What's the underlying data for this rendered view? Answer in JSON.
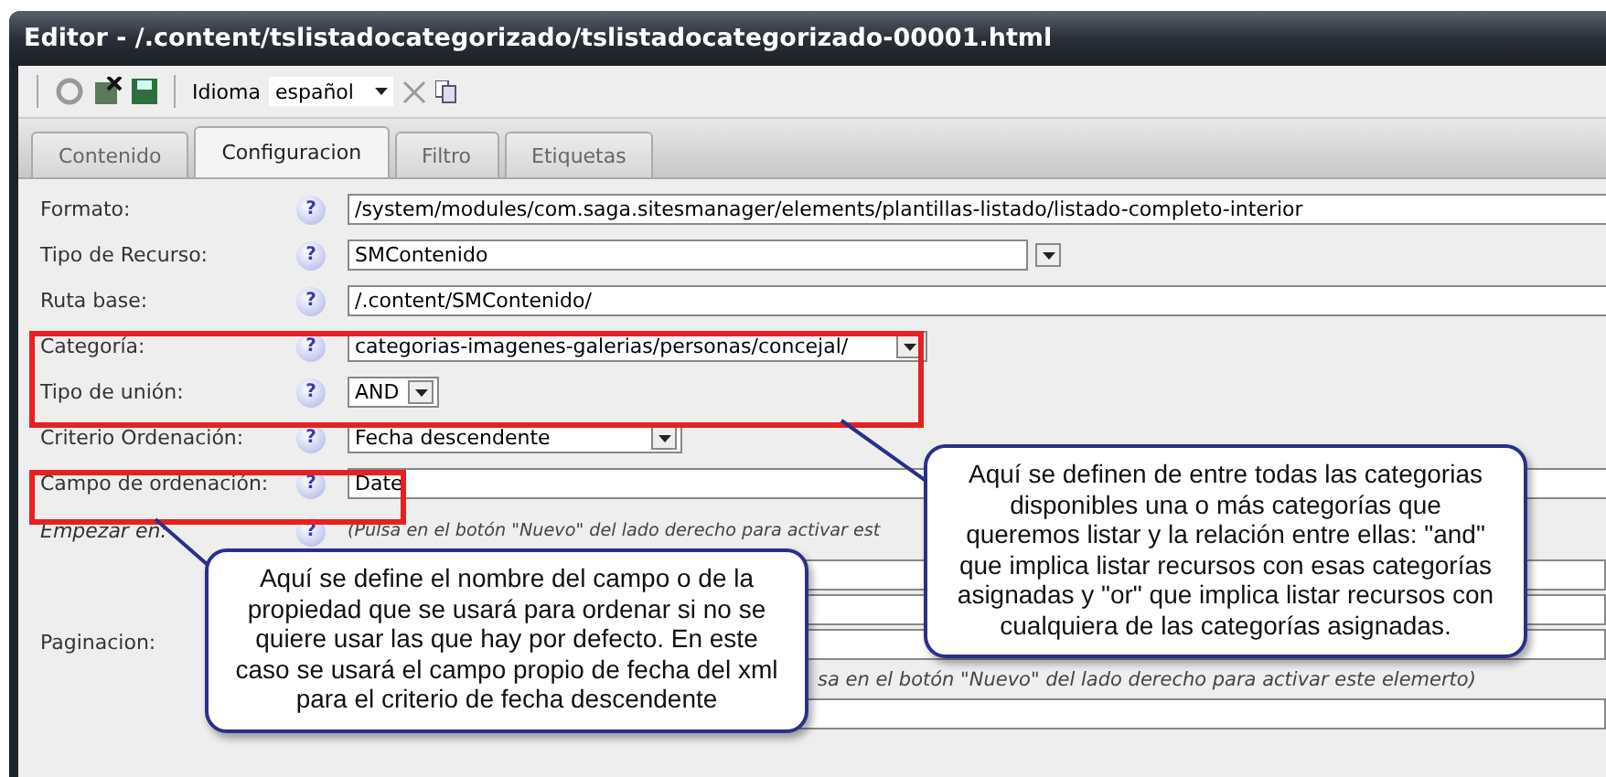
{
  "window": {
    "title": "Editor - /.content/tslistadocategorizado/tslistadocategorizado-00001.html"
  },
  "toolbar": {
    "language_label": "Idioma",
    "language": "español"
  },
  "tabs": [
    {
      "label": "Contenido",
      "selected": false
    },
    {
      "label": "Configuracion",
      "selected": true
    },
    {
      "label": "Filtro",
      "selected": false
    },
    {
      "label": "Etiquetas",
      "selected": false
    }
  ],
  "fields": [
    {
      "label": "Formato:",
      "help": "?",
      "kind": "text",
      "value": "/system/modules/com.saga.sitesmanager/elements/plantillas-listado/listado-completo-interior"
    },
    {
      "label": "Tipo de Recurso:",
      "help": "?",
      "kind": "combo",
      "value": "SMContenido"
    },
    {
      "label": "Ruta base:",
      "help": "?",
      "kind": "text",
      "value": "/.content/SMContenido/"
    },
    {
      "label": "Categoría:",
      "help": "?",
      "kind": "select",
      "value": "categorias-imagenes-galerias/personas/concejal/"
    },
    {
      "label": "Tipo de unión:",
      "help": "?",
      "kind": "small-select",
      "value": "AND"
    },
    {
      "label": "Criterio Ordenación:",
      "help": "?",
      "kind": "select",
      "value": "Fecha descendente"
    },
    {
      "label": "Campo de ordenación:",
      "help": "?",
      "kind": "text",
      "value": "Date"
    },
    {
      "label": "Empezar en:",
      "help": "?",
      "kind": "hint",
      "hint": "(Pulsa en el botón \"Nuevo\" del lado derecho para activar est"
    },
    {
      "label": "Paginacion:",
      "kind": "group",
      "hint": "sa en el botón \"Nuevo\" del lado derecho para activar este elemerto)"
    }
  ],
  "callouts": [
    {
      "text": "Aquí se definen de entre todas las categorias disponibles una o más categorías que queremos listar y la relación entre ellas: \"and\" que implica listar recursos con esas categorías asignadas y \"or\" que implica listar recursos con cualquiera de las categorías asignadas."
    },
    {
      "text": "Aquí se define el nombre del campo o de la propiedad que se usará para ordenar si no se quiere usar las que hay por defecto. En este caso se usará el campo propio de fecha del xml para el criterio de fecha descendente"
    }
  ]
}
